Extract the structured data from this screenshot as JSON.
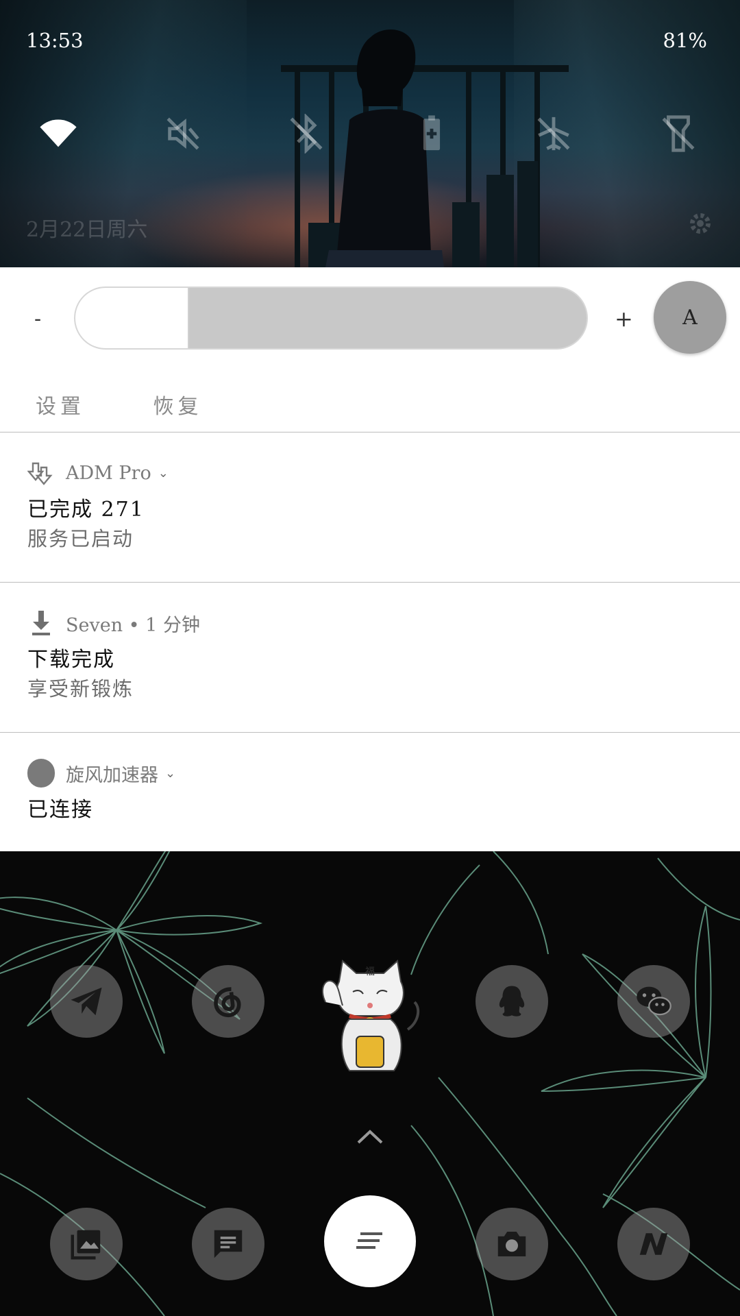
{
  "status_bar": {
    "time": "13:53",
    "battery": "81%"
  },
  "quick_settings": {
    "tiles": [
      "wifi-icon",
      "mute-off-icon",
      "bluetooth-off-icon",
      "battery-saver-icon",
      "airplane-off-icon",
      "flashlight-off-icon"
    ],
    "date_row": "2月22日周六"
  },
  "brightness": {
    "minus": "-",
    "plus": "+",
    "auto_label": "A",
    "level": 0.22
  },
  "actions": {
    "settings": "设置",
    "restore": "恢复"
  },
  "notifications": [
    {
      "app": "ADM Pro",
      "title": "已完成 271",
      "body": "服务已启动"
    },
    {
      "app": "Seven • 1 分钟",
      "title": "下载完成",
      "body": "享受新锻炼"
    },
    {
      "app": "旋风加速器",
      "title": "已连接"
    }
  ],
  "home": {
    "row1": [
      "telegram-icon",
      "netease-music-icon",
      "lucky-cat-widget",
      "qq-icon",
      "wechat-icon"
    ],
    "dock": [
      "gallery-icon",
      "messages-icon",
      "app-drawer-icon",
      "camera-icon",
      "nova-icon"
    ],
    "colors": {
      "flower_line": "#7fc3a6",
      "icon_bg": "#8a8a8a"
    }
  }
}
